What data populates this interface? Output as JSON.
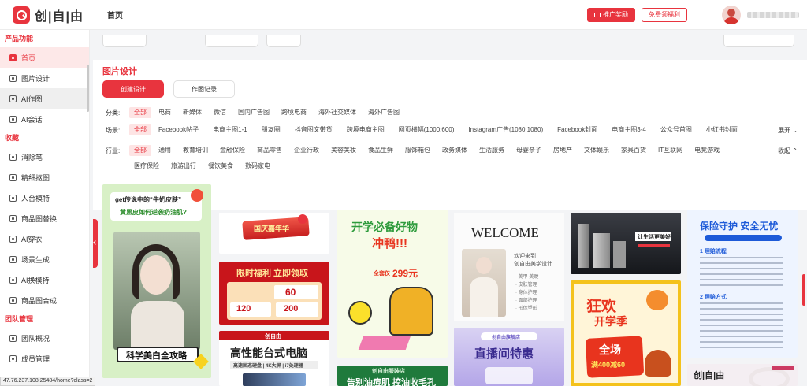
{
  "header": {
    "logo_text": "创|自|由",
    "home": "首页",
    "promo_button": "推广奖励",
    "free_button": "免费领福利"
  },
  "sidebar": {
    "sections": [
      {
        "title": "产品功能",
        "items": [
          "首页",
          "图片设计",
          "AI作图",
          "AI会话"
        ]
      },
      {
        "title": "收藏",
        "items": [
          "消除笔",
          "精细抠图",
          "人台模特",
          "商品图替换",
          "AI穿衣",
          "场景生成",
          "AI换模特",
          "商品图合成"
        ]
      },
      {
        "title": "团队管理",
        "items": [
          "团队概况",
          "成员管理"
        ]
      }
    ]
  },
  "status_bar": "47.76.237.108:25484/home?class=2",
  "panel": {
    "title": "图片设计",
    "create_button": "创建设计",
    "records_button": "作图记录"
  },
  "filters": {
    "category": {
      "label": "分类:",
      "selected": "全部",
      "options": [
        "全部",
        "电商",
        "新媒体",
        "微信",
        "国内广告图",
        "跨境电商",
        "海外社交媒体",
        "海外广告图"
      ]
    },
    "scene": {
      "label": "场景:",
      "selected": "全部",
      "options": [
        "全部",
        "Facebook帖子",
        "电商主图1-1",
        "朋友圈",
        "抖音图文带货",
        "跨境电商主图",
        "网页横幅(1000:600)",
        "Instagram广告(1080:1080)",
        "Facebook封面",
        "电商主图3-4",
        "公众号首图",
        "小红书封面"
      ],
      "toggle": "展开"
    },
    "industry": {
      "label": "行业:",
      "selected": "全部",
      "options": [
        "全部",
        "通用",
        "教育培训",
        "金融保险",
        "商品零售",
        "企业行政",
        "美容美妆",
        "食品生鲜",
        "服饰箱包",
        "政务媒体",
        "生活服务",
        "母婴亲子",
        "房地产",
        "文体娱乐",
        "家具百货",
        "IT互联网",
        "电竞游戏"
      ],
      "options_row2": [
        "医疗保险",
        "旅游出行",
        "餐饮美食",
        "数码家电"
      ],
      "toggle": "收起"
    }
  },
  "gallery": {
    "c1": {
      "headline": "get传说中的“牛奶皮肤”",
      "sub": "黄黑皮如何逆袭奶油肌?",
      "bottom": "科学美白全攻略"
    },
    "c2": {
      "badge": "国庆嘉年华"
    },
    "c3": {
      "title": "限时福利 立即领取",
      "coupon1": "60",
      "coupon2": "120",
      "coupon3": "200"
    },
    "c4": {
      "brand": "创自由",
      "title": "高性能台式电脑",
      "specs": "高速固态硬盘 | 4K大屏 | i7处理器"
    },
    "c5": {
      "line1": "开学必备好物",
      "line2": "冲鸭!!!",
      "price": "299元",
      "price_label": "全套仅"
    },
    "c6": {
      "brand": "创自由服装店",
      "title": "告别油痘肌 控油收毛孔"
    },
    "c7": {
      "title": "WELCOME",
      "sub1": "欢迎来到",
      "sub2": "创自由美学设计",
      "list": [
        "· 美甲 美睫",
        "· 皮肤管理",
        "· 身体护理",
        "· 面部护理",
        "· 形体塑形"
      ]
    },
    "c8": {
      "brand": "创自由旗舰店",
      "title": "直播间特惠"
    },
    "c9": {
      "sign": "让生活更美好"
    },
    "c10": {
      "title1": "狂欢",
      "title2": "开学季",
      "big": "全场",
      "deal": "满400减60"
    },
    "c11": {
      "title": "保险守护 安全无忧",
      "sec1": "1 理赔流程",
      "sec2": "2 理赔方式"
    },
    "c12": {
      "brand": "创|自|由"
    }
  }
}
